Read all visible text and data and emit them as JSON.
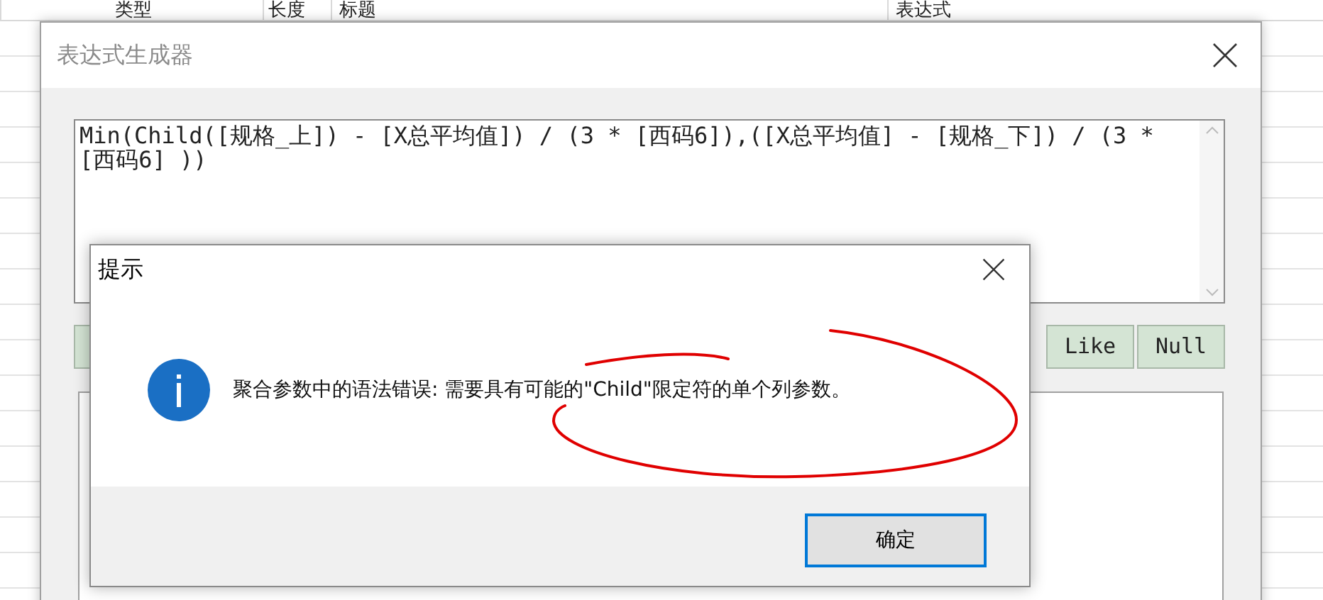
{
  "background_table": {
    "columns": [
      "类型",
      "长度",
      "标题",
      "表达式"
    ]
  },
  "expression_builder": {
    "title": "表达式生成器",
    "expression": "Min(Child([规格_上]) - [X总平均值]) / (3 * [西码6]),([X总平均值] - [规格_下]) / (3 *[西码6] ))",
    "operator_buttons": [
      "Like",
      "Null"
    ]
  },
  "message_box": {
    "title": "提示",
    "message": "聚合参数中的语法错误: 需要具有可能的\"Child\"限定符的单个列参数。",
    "buttons": [
      "确定"
    ]
  }
}
